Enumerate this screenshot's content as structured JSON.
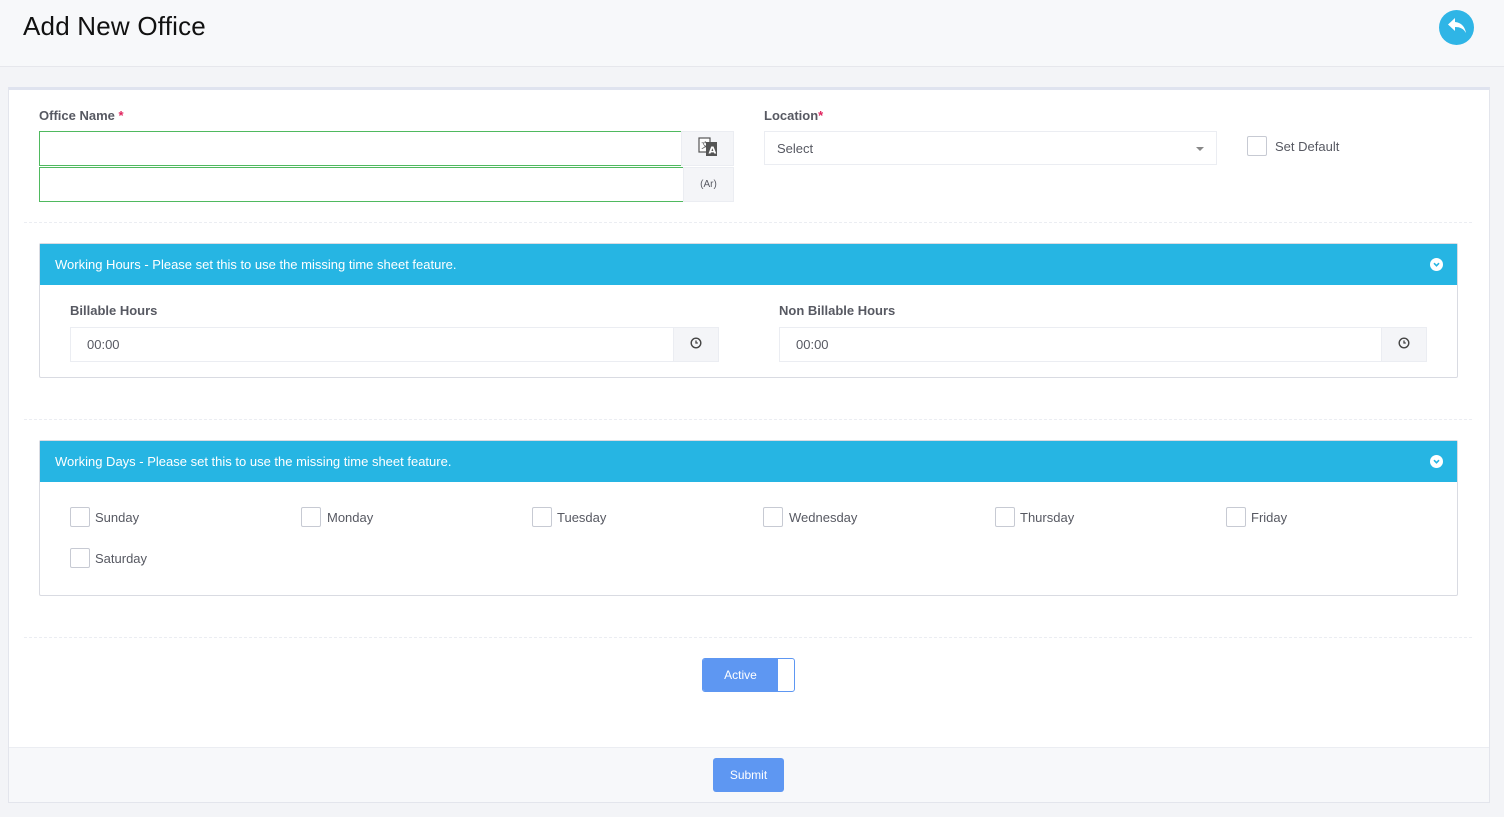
{
  "header": {
    "title": "Add New Office",
    "back_icon": "reply-icon",
    "accent_color": "#2fb5e6"
  },
  "form": {
    "office_name": {
      "label": "Office Name",
      "required_mark": "*",
      "value_en": "",
      "value_ar": "",
      "translate_icon": "translate-icon",
      "ar_addon": "(Ar)"
    },
    "location": {
      "label": "Location",
      "required_mark": "*",
      "selected": "Select"
    },
    "set_default": {
      "label": "Set Default",
      "checked": false
    }
  },
  "working_hours": {
    "title": "Working Hours - Please set this to use the missing time sheet feature.",
    "billable": {
      "label": "Billable Hours",
      "value": "00:00"
    },
    "non_billable": {
      "label": "Non Billable Hours",
      "value": "00:00"
    },
    "clock_icon": "clock-icon",
    "header_color": "#26b5e3"
  },
  "working_days": {
    "title": "Working Days - Please set this to use the missing time sheet feature.",
    "days": [
      {
        "label": "Sunday",
        "checked": false
      },
      {
        "label": "Monday",
        "checked": false
      },
      {
        "label": "Tuesday",
        "checked": false
      },
      {
        "label": "Wednesday",
        "checked": false
      },
      {
        "label": "Thursday",
        "checked": false
      },
      {
        "label": "Friday",
        "checked": false
      },
      {
        "label": "Saturday",
        "checked": false
      }
    ]
  },
  "status": {
    "active_label": "Active",
    "active": true
  },
  "footer": {
    "submit_label": "Submit",
    "button_color": "#5e97f2"
  }
}
